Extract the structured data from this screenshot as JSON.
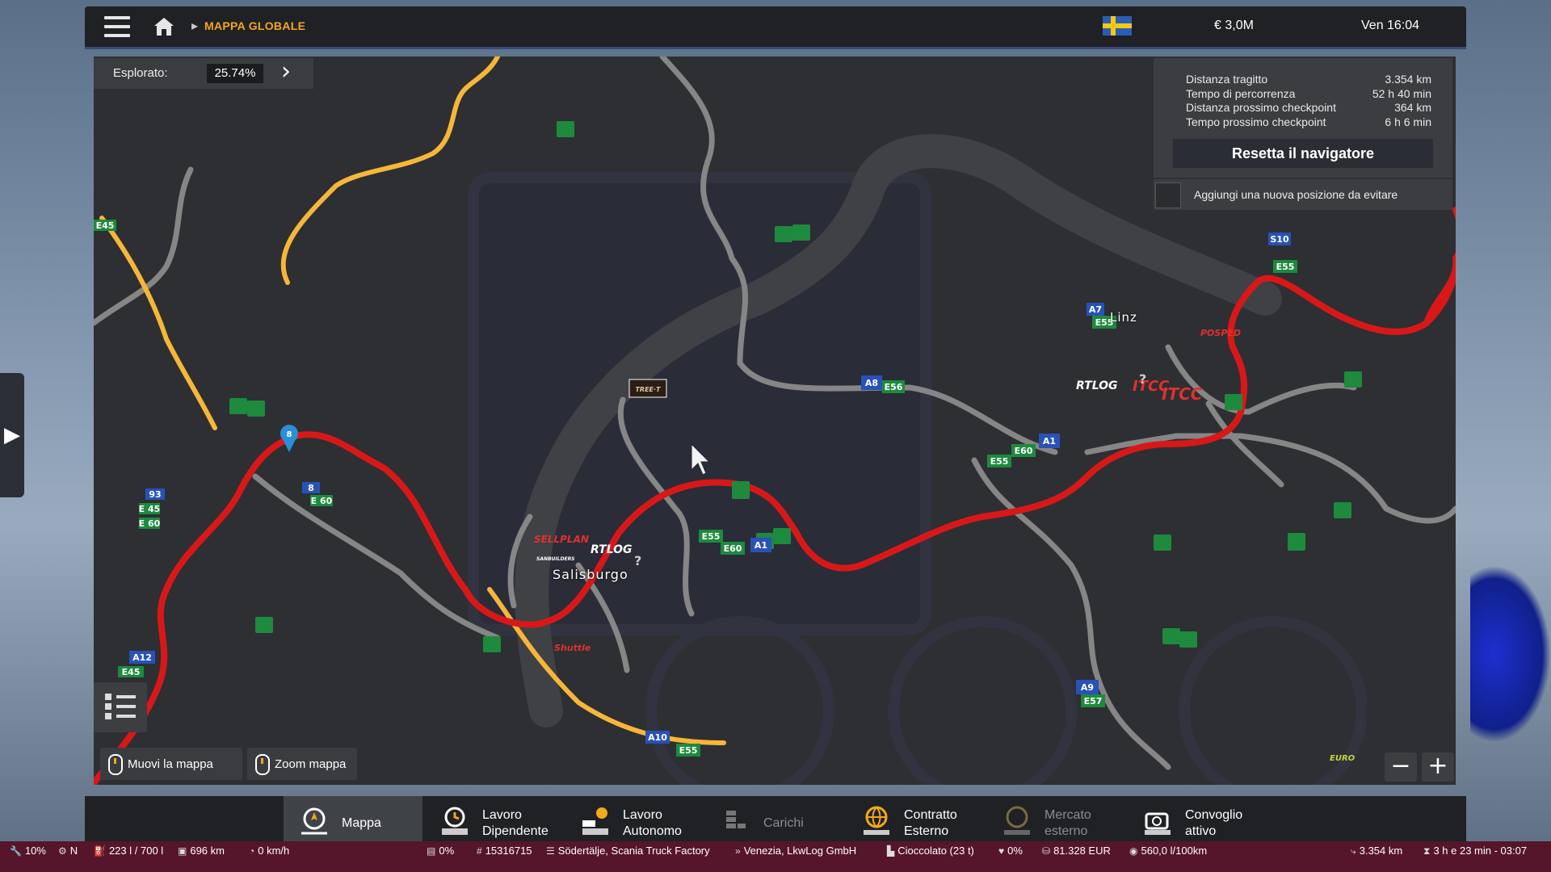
{
  "topbar": {
    "breadcrumb": "MAPPA GLOBALE",
    "money": "€ 3,0M",
    "time": "Ven 16:04"
  },
  "explored": {
    "label": "Esplorato:",
    "value": "25.74%"
  },
  "route": {
    "rows": [
      {
        "label": "Distanza tragitto",
        "value": "3.354 km"
      },
      {
        "label": "Tempo di percorrenza",
        "value": "52 h 40 min"
      },
      {
        "label": "Distanza prossimo checkpoint",
        "value": "364 km"
      },
      {
        "label": "Tempo prossimo checkpoint",
        "value": "6 h 6 min"
      }
    ],
    "reset_label": "Resetta il navigatore",
    "avoid_label": "Aggiungi una nuova posizione da evitare"
  },
  "map": {
    "cities": {
      "salzburg": "Salisburgo",
      "linz": "Linz"
    },
    "road_signs": {
      "e45_a": "E45",
      "e45_b": "E 45",
      "e45_c": "E45",
      "n93": "93",
      "e60_a": "E 60",
      "e60_b": "E 60",
      "e60_c": "E60",
      "e60_d": "E60",
      "a12": "A12",
      "n8": "8",
      "a8": "A8",
      "e56": "E56",
      "e55_a": "E55",
      "e55_b": "E55",
      "e55_c": "E55",
      "e55_d": "E55",
      "e55_e": "E55",
      "a1_a": "A1",
      "a1_b": "A1",
      "a7": "A7",
      "s10": "S10",
      "a9": "A9",
      "e57": "E57",
      "a10": "A10",
      "pin": "8"
    },
    "company_logos": {
      "rtlog_a": "RTLOG",
      "rtlog_b": "RTLOG",
      "itcc": "ITCC",
      "itcc_small": "ITCC",
      "sellplan": "SELLPLAN",
      "sanbuilders": "SANBUILDERS",
      "shuttle": "Shuttle",
      "tree": "TREE·T",
      "posped": "POSPED",
      "eurogoodies": "EURO"
    },
    "hints": {
      "move": "Muovi la mappa",
      "zoom": "Zoom mappa"
    },
    "zoom_out": "−",
    "zoom_in": "+"
  },
  "nav": {
    "tabs": [
      {
        "label": "Mappa",
        "label2": ""
      },
      {
        "label": "Lavoro",
        "label2": "Dipendente"
      },
      {
        "label": "Lavoro",
        "label2": "Autonomo"
      },
      {
        "label": "Carichi",
        "label2": ""
      },
      {
        "label": "Contratto",
        "label2": "Esterno"
      },
      {
        "label": "Mercato",
        "label2": "esterno"
      },
      {
        "label": "Convoglio",
        "label2": "attivo"
      }
    ]
  },
  "status": {
    "damage": "10%",
    "heading": "N",
    "fuel": "223 l / 700 l",
    "range": "696 km",
    "speed": "0 km/h",
    "trailer_damage": "0%",
    "job_id": "15316715",
    "origin": "Södertälje, Scania Truck Factory",
    "destination": "Venezia, LkwLog GmbH",
    "cargo": "Cioccolato (23 t)",
    "cargo_damage": "0%",
    "income": "81.328 EUR",
    "consumption": "560,0 l/100km",
    "distance": "3.354 km",
    "eta": "3 h e 23 min - 03:07"
  },
  "colors": {
    "route": "#d81818",
    "major_road": "#f6b63a",
    "road": "#8a8a8a",
    "accent": "#f3a81e",
    "statusbar": "#55152a"
  }
}
